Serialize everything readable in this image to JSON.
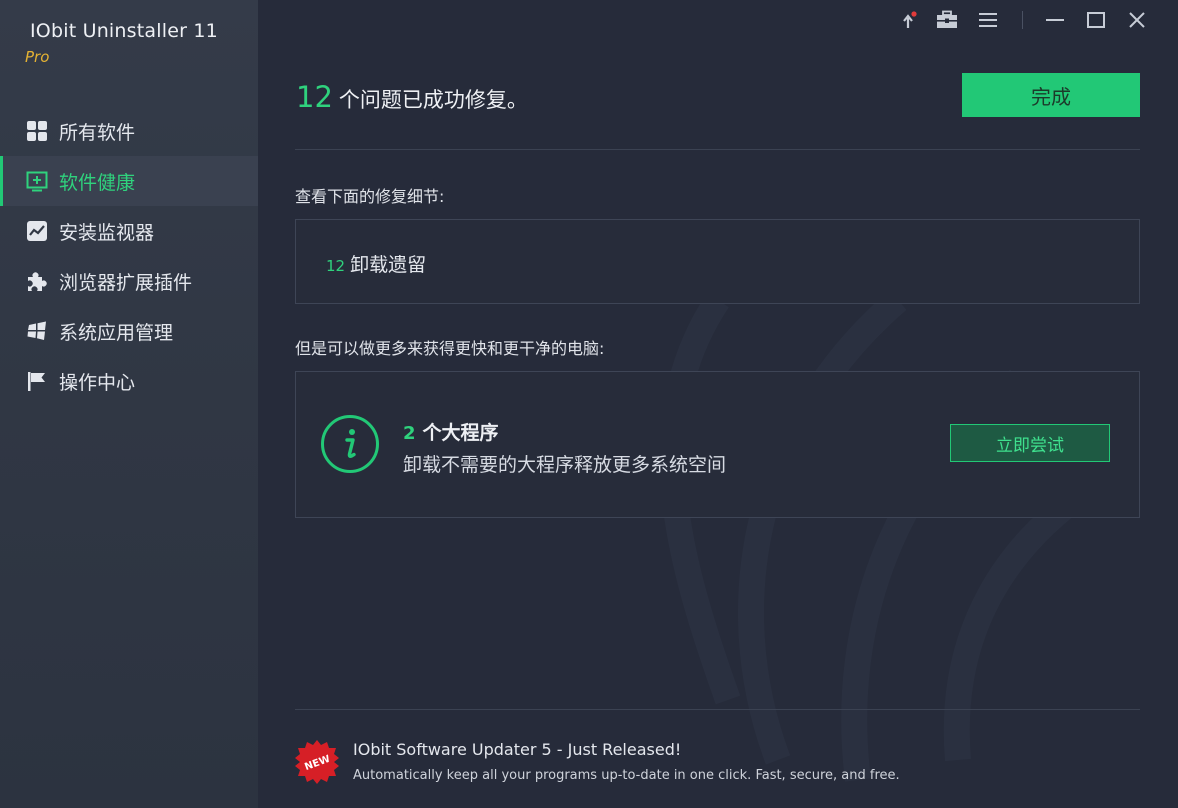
{
  "app": {
    "title": "IObit Uninstaller 11",
    "edition": "Pro"
  },
  "titlebar": {
    "icons": [
      "upgrade-icon",
      "toolbox-icon",
      "menu-icon",
      "minimize-icon",
      "maximize-icon",
      "close-icon"
    ]
  },
  "sidebar": {
    "items": [
      {
        "label": "所有软件",
        "icon": "grid-icon",
        "active": false
      },
      {
        "label": "软件健康",
        "icon": "health-plus-icon",
        "active": true
      },
      {
        "label": "安装监视器",
        "icon": "monitor-chart-icon",
        "active": false
      },
      {
        "label": "浏览器扩展插件",
        "icon": "puzzle-icon",
        "active": false
      },
      {
        "label": "系统应用管理",
        "icon": "windows-icon",
        "active": false
      },
      {
        "label": "操作中心",
        "icon": "flag-icon",
        "active": false
      }
    ]
  },
  "main": {
    "headline_count": "12",
    "headline_text": "个问题已成功修复。",
    "done_label": "完成",
    "details_label": "查看下面的修复细节:",
    "detail_item": {
      "count": "12",
      "text": "卸载遗留"
    },
    "promo_label": "但是可以做更多来获得更快和更干净的电脑:",
    "promo": {
      "count": "2",
      "title": "个大程序",
      "description": "卸载不需要的大程序释放更多系统空间",
      "button_label": "立即尝试"
    }
  },
  "footer": {
    "badge_text": "NEW",
    "title": "IObit Software Updater 5 - Just Released!",
    "description": "Automatically keep all your programs up-to-date in one click. Fast, secure, and free."
  },
  "colors": {
    "accent": "#22c876",
    "accent_text": "#2fd27d",
    "background": "#262b3a",
    "sidebar": "#313845",
    "edition": "#e5b233",
    "badge": "#d61f26"
  }
}
